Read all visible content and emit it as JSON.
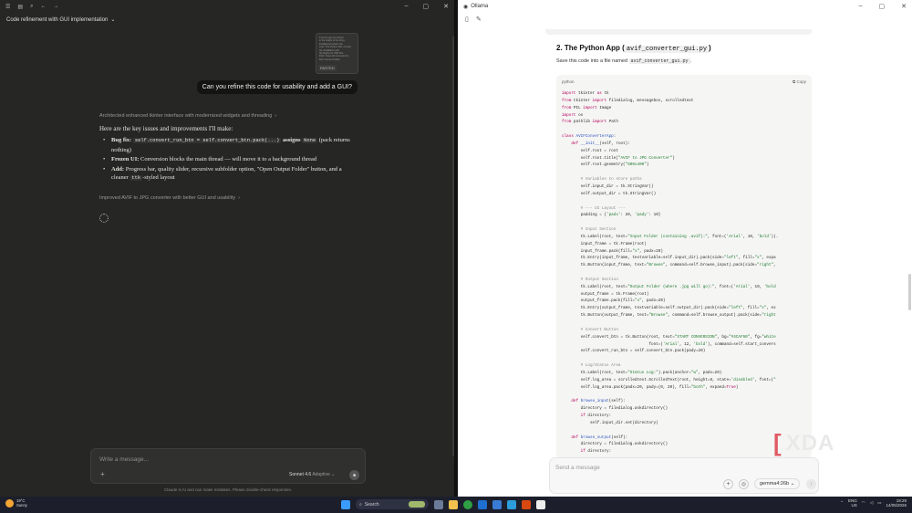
{
  "left_window": {
    "conversation_title": "Code refinement with GUI implementation",
    "pasted_preview_lines": [
      "if you've got any further",
      "in the height of the thing",
      "installed and that's the",
      "exec. The Python File: convert",
      "the installation with",
      "the Rights for PDF File",
      "Path: Class All Converted to",
      "Run Convert Folder"
    ],
    "pasted_badge": "PASTED",
    "user_message": "Can you refine this code for usability and add a GUI?",
    "thought_1": "Architected enhanced tkinter interface with modernized widgets and threading",
    "reply_lead": "Here are the key issues and improvements I'll make:",
    "bullets": [
      {
        "bold": "Bug fix:",
        "code": "self.convert_run_btn = self.convert_btn.pack(...)",
        "mid": "assigns",
        "code2": "None",
        "tail": "(pack returns nothing)"
      },
      {
        "bold": "Frozen UI:",
        "text": "Conversion blocks the main thread — will move it to a background thread"
      },
      {
        "bold": "Add:",
        "text": "Progress bar, quality slider, recursive subfolder option, \"Open Output Folder\" button, and a cleaner",
        "code": "ttk",
        "tail": "-styled layout"
      }
    ],
    "thought_2": "Improved AVIF to JPG converter with better GUI and usability",
    "composer_placeholder": "Write a message...",
    "model_name": "Sonnet 4.6",
    "model_mode": "Adaptive",
    "disclaimer": "Claude is AI and can make mistakes. Please double-check responses."
  },
  "right_window": {
    "app_title": "Ollama",
    "heading": "2. The Python App (",
    "heading_file": "avif_converter_gui.py",
    "heading_close": ")",
    "sub_text": "Save this code into a file named",
    "sub_file": "avif_converter_gui.py",
    "sub_tail": ".",
    "code_lang": "python",
    "copy_label": "Copy",
    "composer_placeholder": "Send a message",
    "model": "gemma4:26b"
  },
  "taskbar": {
    "weather_temp": "19°C",
    "weather_desc": "Sunny",
    "search_label": "Search",
    "lang": "ENG",
    "region": "US",
    "time": "19:29",
    "date": "14/05/2026"
  },
  "watermark": "XDA"
}
